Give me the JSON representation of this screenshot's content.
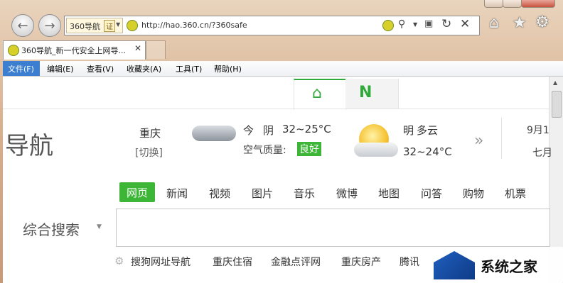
{
  "browser": {
    "site_id_label": "360导航",
    "cert_badge": "证",
    "address": "http://hao.360.cn/?360safe",
    "tab_title": "360导航_新一代安全上网导..."
  },
  "menu": {
    "items": [
      "文件(F)",
      "编辑(E)",
      "查看(V)",
      "收藏夹(A)",
      "工具(T)",
      "帮助(H)"
    ]
  },
  "header": {
    "logo_text": "导航",
    "city": "重庆",
    "switch_label": "[切换]",
    "today": {
      "day": "今",
      "weather": "阴",
      "temp": "32~25°C"
    },
    "air_label": "空气质量:",
    "air_value": "良好",
    "tomorrow": {
      "label": "明",
      "weather": "多云",
      "temp": "32~24°C"
    },
    "more_label": "»",
    "date_partial": "9月1",
    "lunar_partial": "七月"
  },
  "search": {
    "categories": [
      "网页",
      "新闻",
      "视频",
      "图片",
      "音乐",
      "微博",
      "地图",
      "问答",
      "购物",
      "机票"
    ],
    "engine_label": "综合搜索",
    "suggestions": [
      "搜狗网址导航",
      "重庆住宿",
      "金融点评网",
      "重庆房产",
      "腾讯"
    ]
  },
  "watermark": {
    "text": "系统之家"
  },
  "colors": {
    "accent_green": "#3db536",
    "menu_active": "#3c7fd1"
  }
}
